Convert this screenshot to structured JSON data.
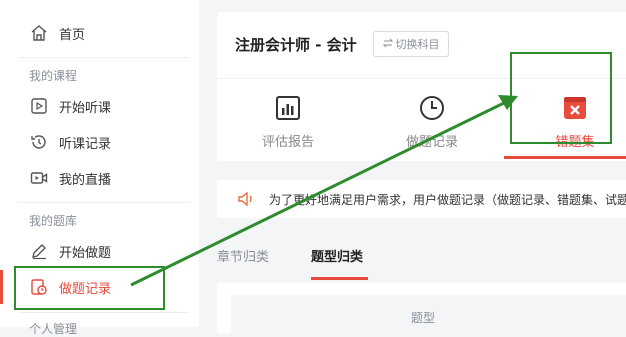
{
  "sidebar": {
    "home_label": "首页",
    "course_section_title": "我的课程",
    "start_listening_label": "开始听课",
    "listening_record_label": "听课记录",
    "my_live_label": "我的直播",
    "question_bank_title": "我的题库",
    "start_practice_label": "开始做题",
    "practice_record_label": "做题记录",
    "personal_title": "个人管理"
  },
  "header": {
    "course_title": "注册会计师 - 会计",
    "switch_button_label": "切换科目",
    "tabs": [
      {
        "label": "评估报告",
        "icon": "report-icon"
      },
      {
        "label": "做题记录",
        "icon": "clock-icon"
      },
      {
        "label": "错题集",
        "icon": "wrong-book-icon"
      }
    ]
  },
  "notice": {
    "text": "为了更好地满足用户需求，用户做题记录（做题记录、错题集、试题"
  },
  "subtabs": {
    "chapter": "章节归类",
    "type": "题型归类"
  },
  "table": {
    "header_type": "题型"
  },
  "colors": {
    "accent": "#e84a3c",
    "annotation": "#2e8b2e"
  }
}
